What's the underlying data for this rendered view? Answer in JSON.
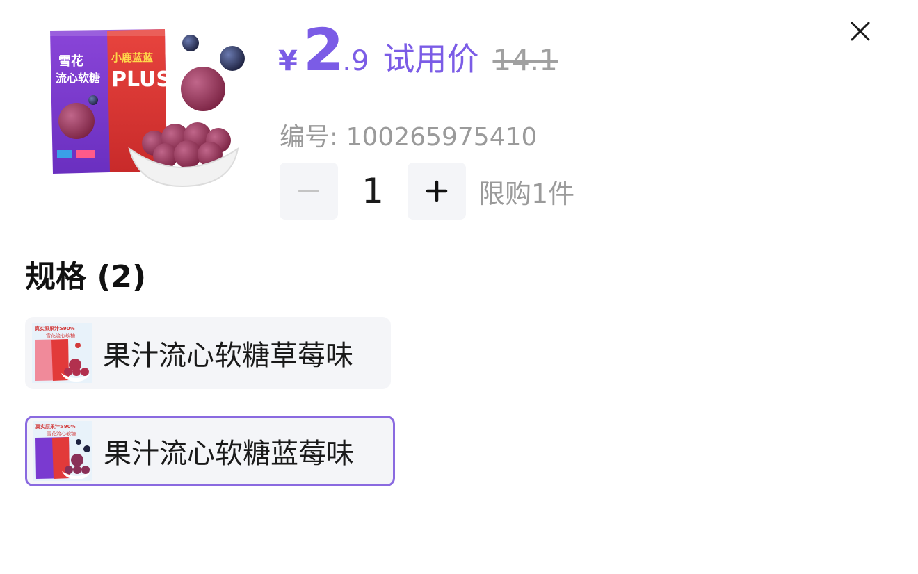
{
  "price": {
    "currency": "¥",
    "integer": "2",
    "decimal": ".9",
    "tag": "试用价",
    "original": "14.1"
  },
  "sku": {
    "label": "编号: 100265975410"
  },
  "quantity": {
    "value": "1",
    "limit_text": "限购1件"
  },
  "specs": {
    "title": "规格 (2)",
    "options": [
      {
        "label": "果汁流心软糖草莓味",
        "selected": false
      },
      {
        "label": "果汁流心软糖蓝莓味",
        "selected": true
      }
    ]
  },
  "product_image": {
    "pack_text_top": "雪花",
    "pack_text_bottom": "流心软糖",
    "pack_brand": "小鹿蓝蓝",
    "pack_plus": "PLUS"
  },
  "thumbs": {
    "banner": "真实原果汁≥90%",
    "sub": "雪花流心软糖"
  },
  "colors": {
    "accent": "#7b5ce6",
    "selected_border": "#8a6ae0",
    "muted_text": "#9a9a9a",
    "option_bg": "#f4f5f8"
  },
  "icons": {
    "close": "close-icon",
    "minus": "minus-icon",
    "plus": "plus-icon"
  }
}
